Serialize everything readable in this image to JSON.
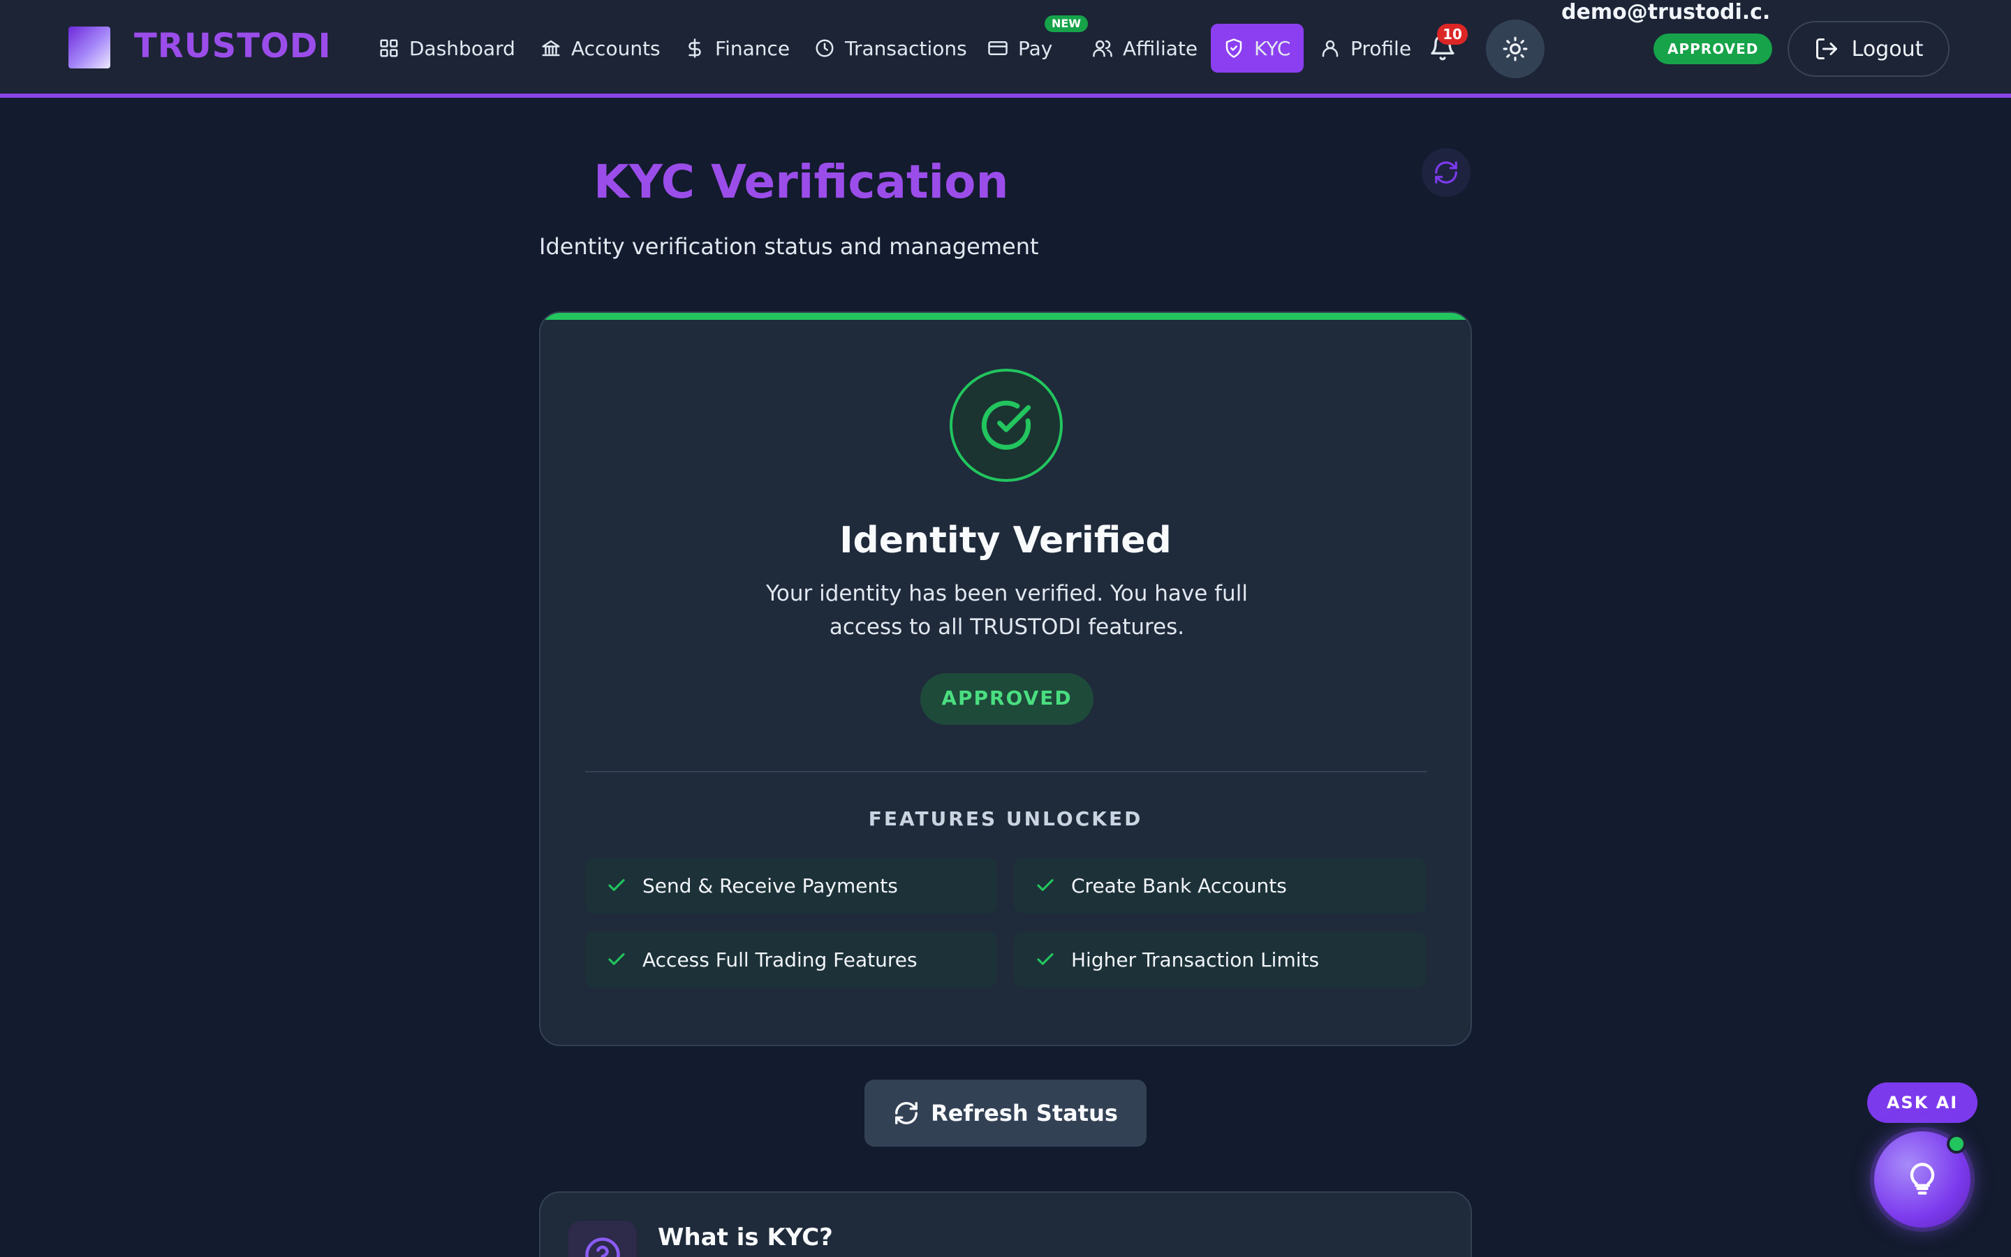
{
  "brand": {
    "name": "TRUSTODI"
  },
  "nav": {
    "items": [
      {
        "label": "Dashboard",
        "icon": "grid-icon"
      },
      {
        "label": "Accounts",
        "icon": "bank-icon"
      },
      {
        "label": "Finance",
        "icon": "dollar-icon"
      },
      {
        "label": "Transactions",
        "icon": "clock-icon"
      },
      {
        "label": "Pay",
        "icon": "credit-card-icon",
        "badge": "NEW"
      },
      {
        "label": "Affiliate",
        "icon": "users-icon"
      },
      {
        "label": "KYC",
        "icon": "shield-icon",
        "active": true
      },
      {
        "label": "Profile",
        "icon": "user-icon"
      }
    ],
    "notifications_count": "10"
  },
  "user": {
    "email": "demo@trustodi.c...",
    "status": "APPROVED",
    "logout_label": "Logout"
  },
  "page": {
    "title": "KYC Verification",
    "subtitle": "Identity verification status and management"
  },
  "status_card": {
    "title": "Identity Verified",
    "description": "Your identity has been verified. You have full access to all TRUSTODI features.",
    "badge": "APPROVED",
    "features_title": "FEATURES UNLOCKED",
    "features": [
      "Send & Receive Payments",
      "Create Bank Accounts",
      "Access Full Trading Features",
      "Higher Transaction Limits"
    ]
  },
  "refresh_button": {
    "label": "Refresh Status"
  },
  "info_card": {
    "title": "What is KYC?"
  },
  "assistant": {
    "label": "ASK AI"
  },
  "colors": {
    "accent": "#8b3ff0",
    "success": "#22c55e",
    "background": "#131b2e",
    "danger": "#dc2626"
  }
}
